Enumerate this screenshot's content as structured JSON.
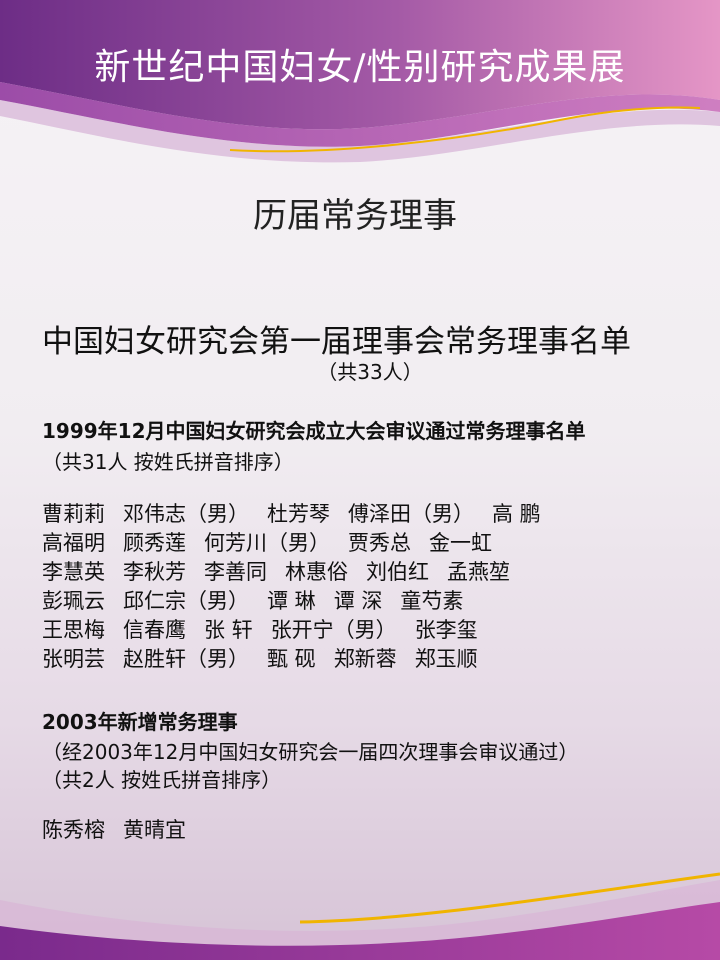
{
  "banner": {
    "title": "新世纪中国妇女/性别研究成果展"
  },
  "slide_title": "历届常务理事",
  "main": {
    "title": "中国妇女研究会第一届理事会常务理事名单",
    "subtitle": "（共33人）"
  },
  "section1": {
    "heading": "1999年12月中国妇女研究会成立大会审议通过常务理事名单",
    "note": "（共31人  按姓氏拼音排序）",
    "rows": [
      [
        "曹莉莉",
        "邓伟志（男）",
        "杜芳琴",
        "傅泽田（男）",
        "高  鹏"
      ],
      [
        "高福明",
        "顾秀莲",
        "何芳川（男）",
        "贾秀总",
        "金一虹"
      ],
      [
        "李慧英",
        "李秋芳",
        "李善同",
        "林惠俗",
        "刘伯红",
        "孟燕堃"
      ],
      [
        "彭珮云",
        "邱仁宗（男）",
        "谭  琳",
        "谭  深",
        "童芍素"
      ],
      [
        "王思梅",
        "信春鹰",
        "张    轩",
        "张开宁（男）",
        "张李玺"
      ],
      [
        "张明芸",
        "赵胜轩（男）",
        "甄  砚",
        "郑新蓉",
        "郑玉顺"
      ]
    ]
  },
  "section2": {
    "heading": "2003年新增常务理事",
    "note1": "（经2003年12月中国妇女研究会一届四次理事会审议通过）",
    "note2": "（共2人  按姓氏拼音排序）",
    "rows": [
      [
        "陈秀榕",
        "黄晴宜"
      ]
    ]
  },
  "colors": {
    "banner_purple": "#7a2a8c",
    "banner_pink": "#d98ac0",
    "accent_gold": "#f0b400",
    "background": "#f3eff3"
  }
}
